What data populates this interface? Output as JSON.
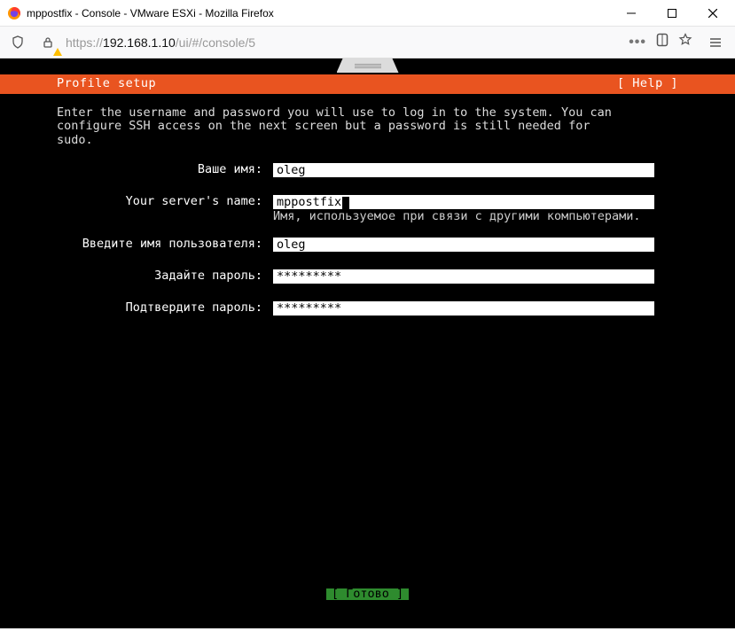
{
  "window": {
    "title": "mppostfix - Console - VMware ESXi - Mozilla Firefox"
  },
  "url": {
    "prefix": "https://",
    "host": "192.168.1.10",
    "path": "/ui/#/console/5"
  },
  "toolbar": {
    "more": "•••"
  },
  "installer": {
    "header_left": "Profile setup",
    "header_right": "[ Help ]",
    "intro": "Enter the username and password you will use to log in to the system. You can\nconfigure SSH access on the next screen but a password is still needed for\nsudo.",
    "fields": {
      "name_label": "Ваше имя:",
      "name_value": "oleg",
      "server_label": "Your server's name:",
      "server_value": "mppostfix",
      "server_hint": "Имя, используемое при связи с другими компьютерами.",
      "user_label": "Введите имя пользователя:",
      "user_value": "oleg",
      "pass_label": "Задайте пароль:",
      "pass_value": "*********",
      "confirm_label": "Подтвердите пароль:",
      "confirm_value": "*********"
    },
    "done": "[ Готово      ]"
  }
}
